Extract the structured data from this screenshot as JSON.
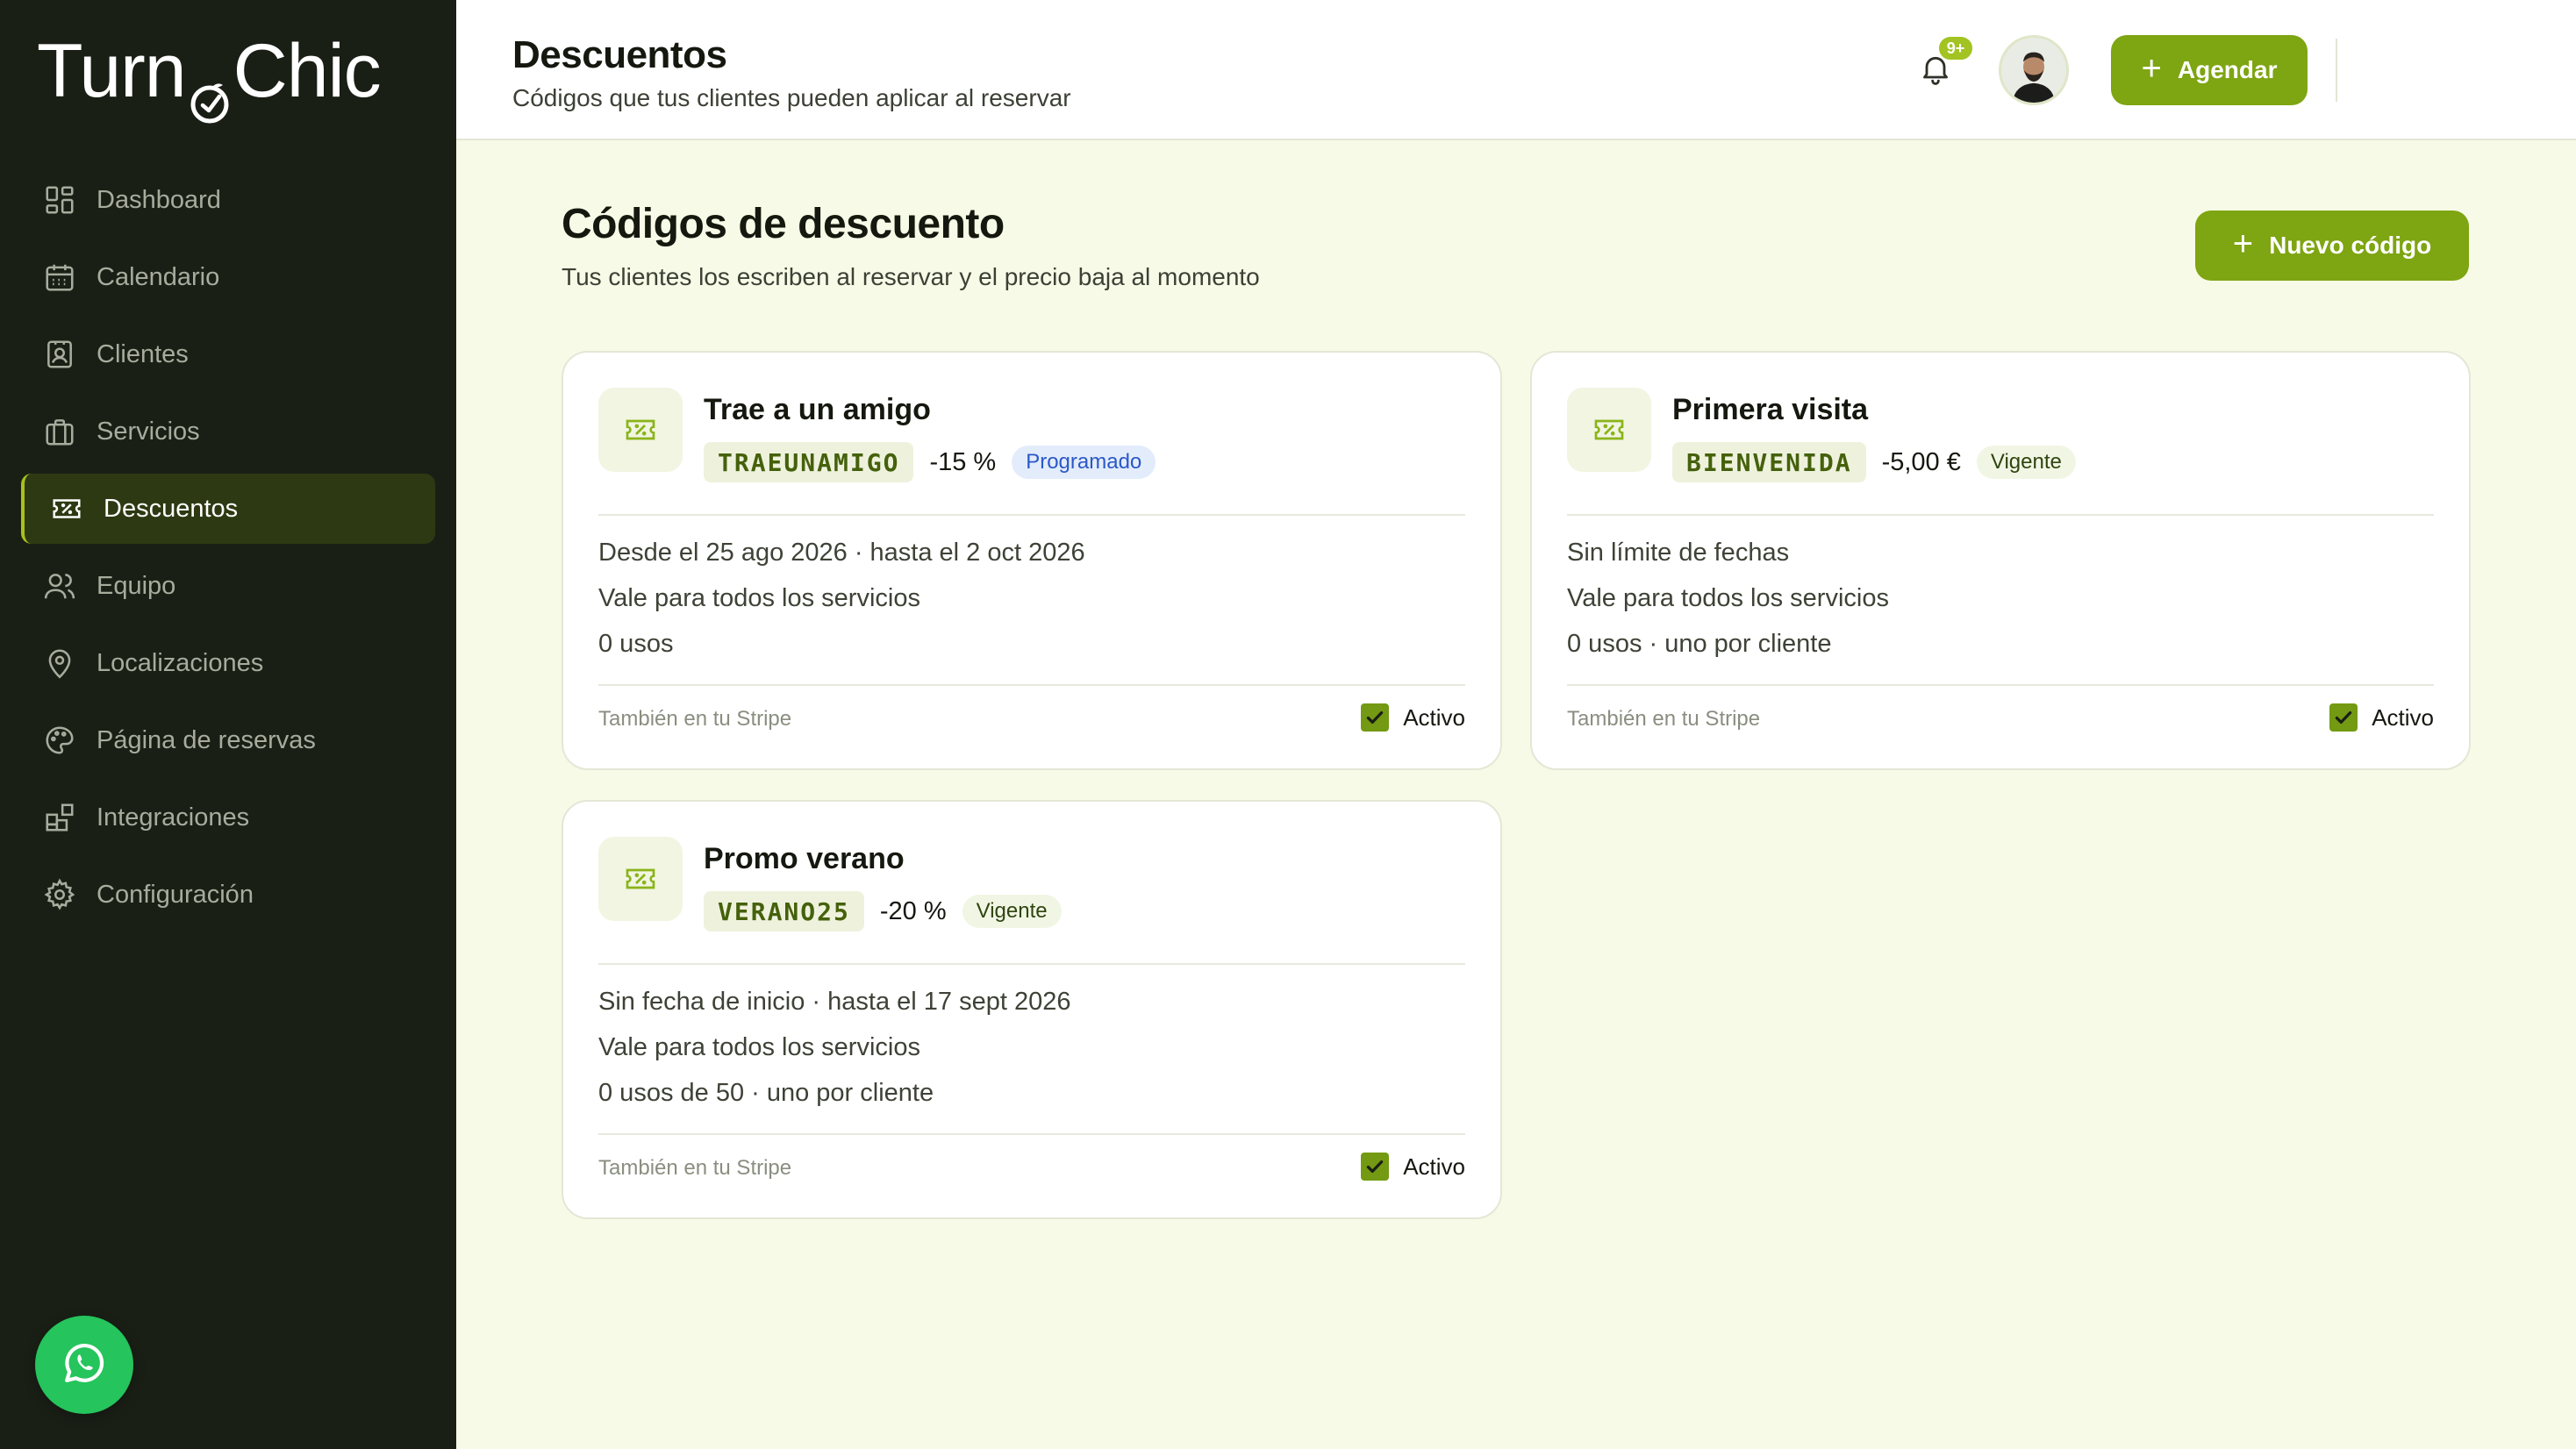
{
  "brand": {
    "name_start": "Turn",
    "name_end": "Chic"
  },
  "sidebar": {
    "items": [
      {
        "label": "Dashboard",
        "icon": "dashboard-icon",
        "active": false
      },
      {
        "label": "Calendario",
        "icon": "calendar-icon",
        "active": false
      },
      {
        "label": "Clientes",
        "icon": "contact-card-icon",
        "active": false
      },
      {
        "label": "Servicios",
        "icon": "briefcase-icon",
        "active": false
      },
      {
        "label": "Descuentos",
        "icon": "ticket-icon",
        "active": true
      },
      {
        "label": "Equipo",
        "icon": "users-icon",
        "active": false
      },
      {
        "label": "Localizaciones",
        "icon": "map-pin-icon",
        "active": false
      },
      {
        "label": "Página de reservas",
        "icon": "palette-icon",
        "active": false
      },
      {
        "label": "Integraciones",
        "icon": "blocks-icon",
        "active": false
      },
      {
        "label": "Configuración",
        "icon": "gear-icon",
        "active": false
      }
    ]
  },
  "header": {
    "title": "Descuentos",
    "subtitle": "Códigos que tus clientes pueden aplicar al reservar",
    "agendar_label": "Agendar",
    "notifications_badge": "9+"
  },
  "main": {
    "title": "Códigos de descuento",
    "subtitle": "Tus clientes los escriben al reservar y el precio baja al momento",
    "new_code_label": "Nuevo código",
    "cards": [
      {
        "title": "Trae a un amigo",
        "code": "TRAEUNAMIGO",
        "amount": "-15 %",
        "status": "Programado",
        "line1": "Desde el 25 ago 2026 · hasta el 2 oct 2026",
        "line2": "Vale para todos los servicios",
        "line3": "0 usos",
        "stripe": "También en tu Stripe",
        "active_label": "Activo",
        "active": true
      },
      {
        "title": "Primera visita",
        "code": "BIENVENIDA",
        "amount": "-5,00 €",
        "status": "Vigente",
        "line1": "Sin límite de fechas",
        "line2": "Vale para todos los servicios",
        "line3": "0 usos · uno por cliente",
        "stripe": "También en tu Stripe",
        "active_label": "Activo",
        "active": true
      },
      {
        "title": "Promo verano",
        "code": "VERANO25",
        "amount": "-20 %",
        "status": "Vigente",
        "line1": "Sin fecha de inicio · hasta el 17 sept 2026",
        "line2": "Vale para todos los servicios",
        "line3": "0 usos de 50 · uno por cliente",
        "stripe": "También en tu Stripe",
        "active_label": "Activo",
        "active": true
      }
    ]
  },
  "colors": {
    "sidebar_bg": "#1a1f16",
    "accent_green": "#7ea512",
    "page_bg": "#f7fae6",
    "status_programado": "#2a58c7",
    "whatsapp": "#25c45c"
  }
}
